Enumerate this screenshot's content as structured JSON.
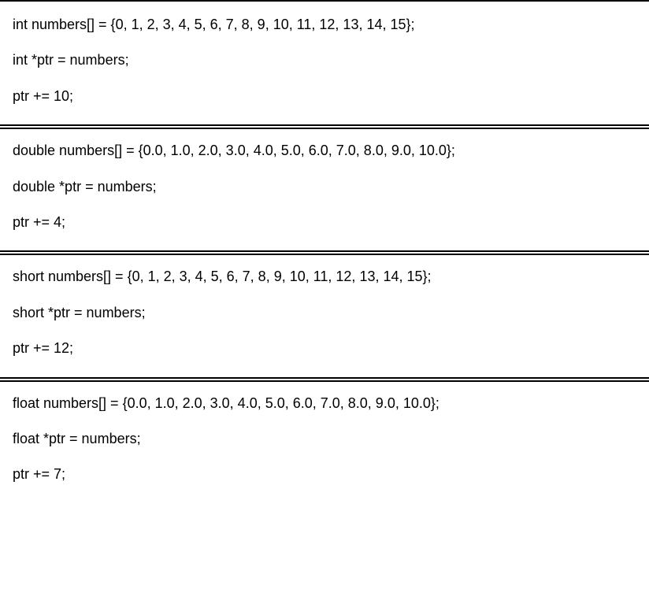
{
  "blocks": [
    {
      "lines": [
        "int numbers[] = {0, 1, 2, 3, 4, 5, 6, 7, 8, 9, 10, 11, 12, 13, 14, 15};",
        "int *ptr = numbers;",
        "ptr += 10;"
      ]
    },
    {
      "lines": [
        "double numbers[] = {0.0, 1.0, 2.0, 3.0, 4.0, 5.0, 6.0, 7.0, 8.0, 9.0, 10.0};",
        "double *ptr = numbers;",
        "ptr += 4;"
      ]
    },
    {
      "lines": [
        "short numbers[] = {0, 1, 2, 3, 4, 5, 6, 7, 8, 9, 10, 11, 12, 13, 14, 15};",
        "short *ptr = numbers;",
        "ptr += 12;"
      ]
    },
    {
      "lines": [
        "float numbers[] = {0.0, 1.0, 2.0, 3.0, 4.0, 5.0, 6.0, 7.0, 8.0, 9.0, 10.0};",
        "float *ptr = numbers;",
        "ptr += 7;"
      ]
    }
  ]
}
